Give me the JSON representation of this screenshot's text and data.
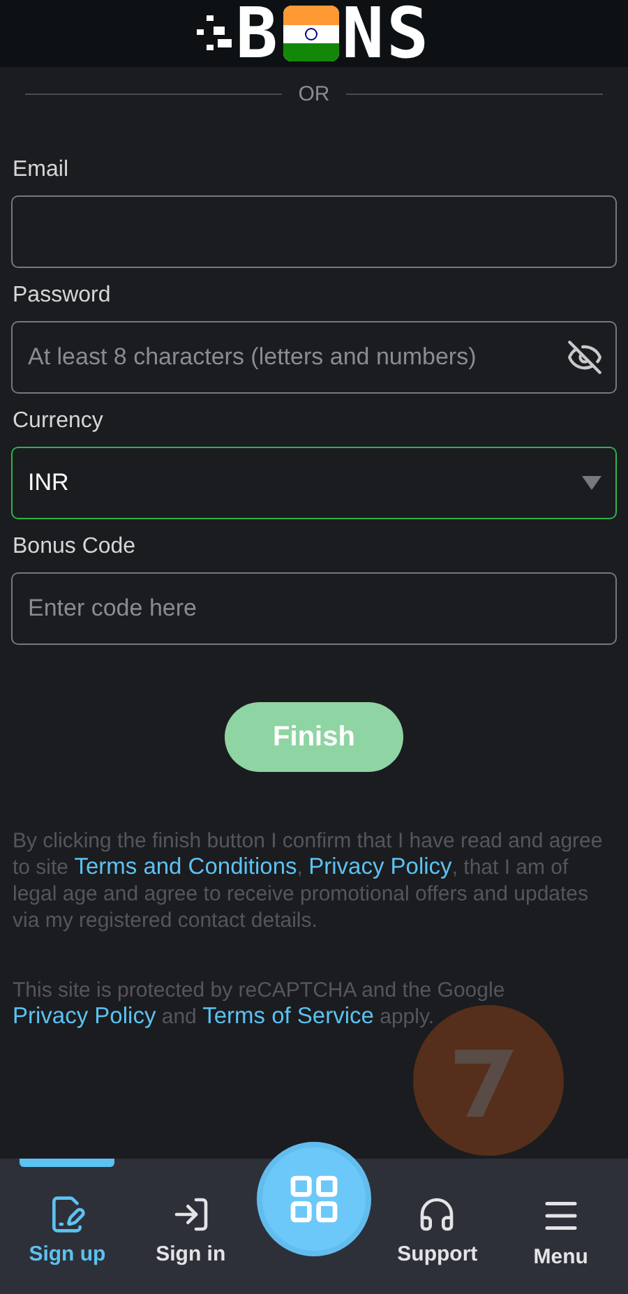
{
  "logo": {
    "before": "B",
    "after": "NS"
  },
  "divider": {
    "label": "OR"
  },
  "fields": [
    {
      "kind": "text",
      "label": "Email"
    },
    {
      "kind": "password",
      "label": "Password",
      "placeholder": "At least 8 characters (letters and numbers)"
    },
    {
      "kind": "select",
      "label": "Currency",
      "value": "INR",
      "focused": true
    },
    {
      "kind": "text",
      "label": "Bonus Code",
      "placeholder": "Enter code here"
    }
  ],
  "submit": {
    "label": "Finish"
  },
  "consent": [
    {
      "kind": "text",
      "text": "By clicking the finish button I confirm that I have read and agree to site "
    },
    {
      "kind": "link",
      "text": "Terms and Conditions"
    },
    {
      "kind": "text",
      "text": ", "
    },
    {
      "kind": "link",
      "text": "Privacy Policy"
    },
    {
      "kind": "text",
      "text": ", that I am of legal age and agree to receive promotional offers and updates via my registered contact details."
    }
  ],
  "recaptcha": [
    {
      "kind": "text",
      "text": "This site is protected by reCAPTCHA and the Google "
    },
    {
      "kind": "link",
      "text": "Privacy Policy"
    },
    {
      "kind": "text",
      "text": " and "
    },
    {
      "kind": "link",
      "text": "Terms of Service"
    },
    {
      "kind": "text",
      "text": " apply."
    }
  ],
  "nav": [
    {
      "kind": "signup",
      "label": "Sign up",
      "selected": true
    },
    {
      "kind": "signin",
      "label": "Sign in",
      "selected": false
    },
    {
      "kind": "center"
    },
    {
      "kind": "support",
      "label": "Support",
      "selected": false
    },
    {
      "kind": "menu",
      "label": "Menu",
      "selected": false
    }
  ]
}
